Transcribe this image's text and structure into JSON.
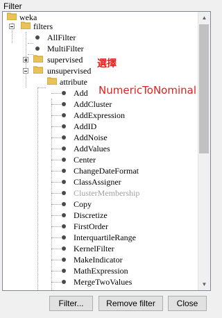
{
  "window": {
    "title": "Filter"
  },
  "tree": {
    "root": "weka",
    "filters": "filters",
    "all_filter": "AllFilter",
    "multi_filter": "MultiFilter",
    "supervised": "supervised",
    "unsupervised": "unsupervised",
    "attribute": "attribute",
    "attribute_items": [
      "Add",
      "AddCluster",
      "AddExpression",
      "AddID",
      "AddNoise",
      "AddValues",
      "Center",
      "ChangeDateFormat",
      "ClassAssigner",
      "ClusterMembership",
      "Copy",
      "Discretize",
      "FirstOrder",
      "InterquartileRange",
      "KernelFilter",
      "MakeIndicator",
      "MathExpression",
      "MergeTwoValues"
    ]
  },
  "annotation": {
    "line1": "選擇",
    "line2": "NumericToNominal",
    "color": "#e0201b"
  },
  "buttons": {
    "filter": "Filter...",
    "remove": "Remove filter",
    "close": "Close"
  },
  "icons": {
    "folder": "folder-icon",
    "leaf": "bullet-icon",
    "expand": "plus-icon",
    "collapse": "minus-icon"
  }
}
